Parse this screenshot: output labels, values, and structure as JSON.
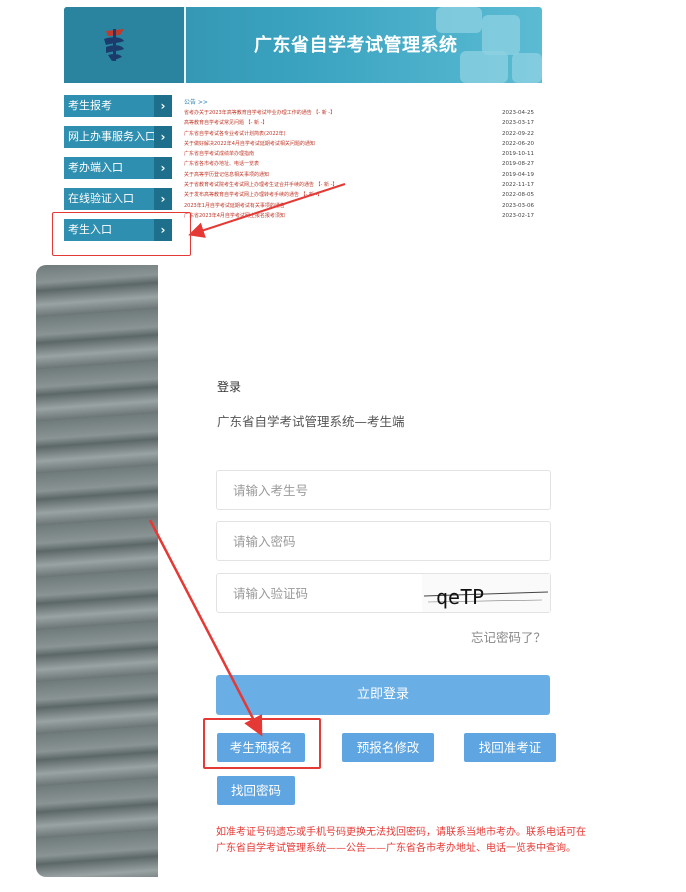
{
  "site": {
    "title": "广东省自学考试管理系统"
  },
  "nav": {
    "items": [
      {
        "label": "考生报考"
      },
      {
        "label": "网上办事服务入口"
      },
      {
        "label": "考办端入口"
      },
      {
        "label": "在线验证入口"
      },
      {
        "label": "考生入口"
      }
    ]
  },
  "notices": {
    "header": "公告 >>",
    "items": [
      {
        "title": "省考办关于2023年高等教育自学考试毕业办理工作的通告 【- 新 -】",
        "date": "2023-04-25",
        "style": "red"
      },
      {
        "title": "高等教育自学考试常见问题 【- 新 -】",
        "date": "2023-03-17",
        "style": "red"
      },
      {
        "title": "广东省自学考试各专业考试计划简表(2022年)",
        "date": "2022-09-22",
        "style": "red"
      },
      {
        "title": "关于做好解决2022年4月自学考试延期考试相关问题的通知",
        "date": "2022-06-20",
        "style": "red"
      },
      {
        "title": "广东省自学考试成绩单办理指南",
        "date": "2019-10-11",
        "style": "red"
      },
      {
        "title": "广东省各市考办地址、电话一览表",
        "date": "2019-08-27",
        "style": "red"
      },
      {
        "title": "关于高等学历登记信息相关事项的通知",
        "date": "2019-04-19",
        "style": "red"
      },
      {
        "title": "关于省教育考试院考生考试网上办理考生证合并手续的通告 【- 新 -】",
        "date": "2022-11-17",
        "style": "red"
      },
      {
        "title": "关于发布高等教育自学考试网上办理转考手续的通告 【- 新 -】",
        "date": "2022-08-05",
        "style": "red"
      },
      {
        "title": "2023年1月自学考试延期考试有关事项的通告",
        "date": "2023-03-06",
        "style": "red"
      },
      {
        "title": "广东省2023年4月自学考试网上报名报考须知",
        "date": "2023-02-17",
        "style": "red"
      }
    ]
  },
  "login": {
    "title": "登录",
    "subtitle": "广东省自学考试管理系统—考生端",
    "candidate_placeholder": "请输入考生号",
    "password_placeholder": "请输入密码",
    "captcha_placeholder": "请输入验证码",
    "captcha_text": "qeTP",
    "forgot_label": "忘记密码了？",
    "submit_label": "立即登录",
    "btn_prereg": "考生预报名",
    "btn_modify": "预报名修改",
    "btn_ticket": "找回准考证",
    "btn_password": "找回密码",
    "notice_line1": "如准考证号码遗忘或手机号码更换无法找回密码，请联系当地市考办。联系电话可在",
    "notice_line2": "广东省自学考试管理系统——公告——广东省各市考办地址、电话一览表中查询。"
  },
  "colors": {
    "banner": "#2f8ea9",
    "nav": "#2e8fb0",
    "button": "#5ea5e2",
    "annotation": "#e53935",
    "notice_text": "#e53935"
  }
}
